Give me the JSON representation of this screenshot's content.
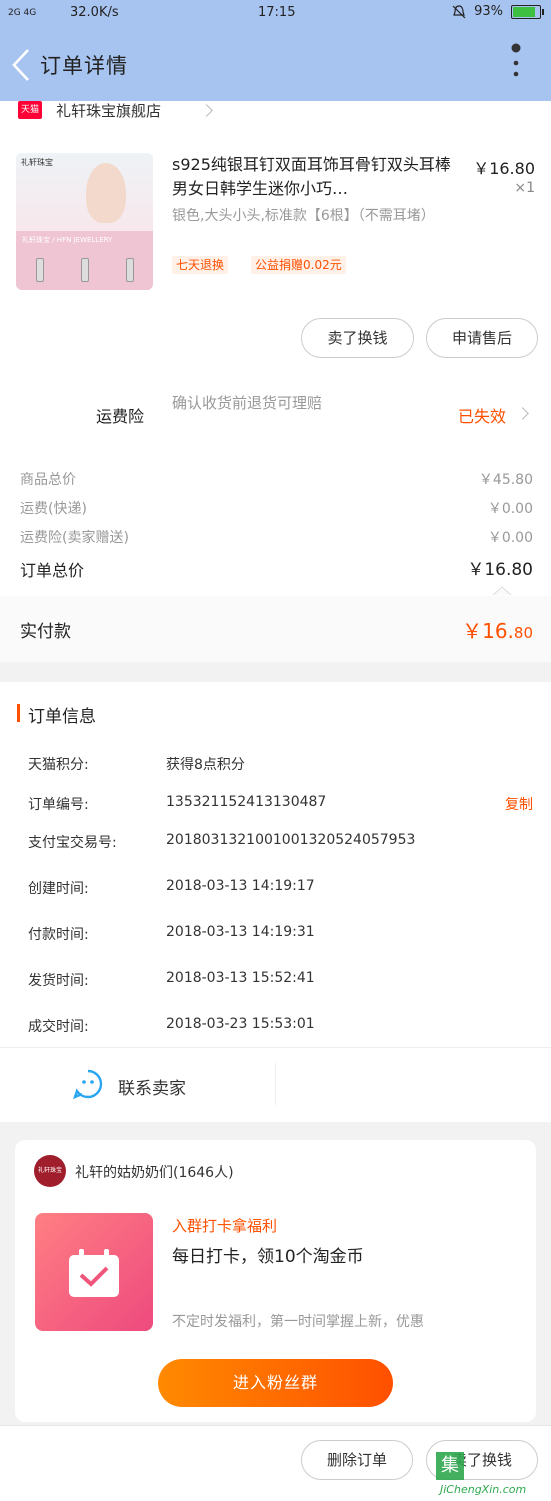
{
  "status_bar": {
    "signal": "2G 4G",
    "speed": "32.0K/s",
    "time": "17:15",
    "battery": "93%"
  },
  "header": {
    "title": "订单详情"
  },
  "shop": {
    "badge": "天猫",
    "name": "礼轩珠宝旗舰店"
  },
  "product": {
    "title": "s925纯银耳钉双面耳饰耳骨钉双头耳棒男女日韩学生迷你小巧…",
    "price": "￥16.80",
    "quantity": "×1",
    "sku": "银色,大头小头,标准款【6根】（不需耳堵）",
    "tags": [
      "七天退换",
      "公益捐赠0.02元"
    ],
    "image_caption": "礼轩珠宝 / HFN JEWELLERY"
  },
  "actions": {
    "sell": "卖了换钱",
    "after_sale": "申请售后"
  },
  "insurance": {
    "label": "运费险",
    "desc": "确认收货前退货可理赔",
    "status": "已失效"
  },
  "costs": {
    "rows": [
      {
        "label": "商品总价",
        "value": "￥45.80"
      },
      {
        "label": "运费(快递)",
        "value": "￥0.00"
      },
      {
        "label": "运费险(卖家赠送)",
        "value": "￥0.00"
      }
    ],
    "total_label": "订单总价",
    "total_value": "￥16.80",
    "paid_label": "实付款",
    "paid_main": "￥16.",
    "paid_cents": "80"
  },
  "order_info": {
    "title": "订单信息",
    "copy": "复制",
    "rows": [
      {
        "label": "天猫积分:",
        "value": "获得8点积分"
      },
      {
        "label": "订单编号:",
        "value": "135321152413130487"
      },
      {
        "label": "支付宝交易号:",
        "value": "2018031321001001320524057953"
      },
      {
        "label": "创建时间:",
        "value": "2018-03-13 14:19:17"
      },
      {
        "label": "付款时间:",
        "value": "2018-03-13 14:19:31"
      },
      {
        "label": "发货时间:",
        "value": "2018-03-13 15:52:41"
      },
      {
        "label": "成交时间:",
        "value": "2018-03-23 15:53:01"
      }
    ]
  },
  "contact": {
    "label": "联系卖家"
  },
  "group": {
    "avatar_text": "礼轩珠宝",
    "name": "礼轩的姑奶奶们(1646人)",
    "promo_title": "入群打卡拿福利",
    "promo_main": "每日打卡，领10个淘金币",
    "promo_sub": "不定时发福利，第一时间掌握上新，优惠",
    "join": "进入粉丝群"
  },
  "bottom_bar": {
    "delete": "删除订单",
    "sell": "卖了换钱"
  },
  "watermark": {
    "text": "JiChengXin.com",
    "glyph": "集"
  },
  "colors": {
    "accent": "#ff5000",
    "nav": "#a7c3ef"
  }
}
